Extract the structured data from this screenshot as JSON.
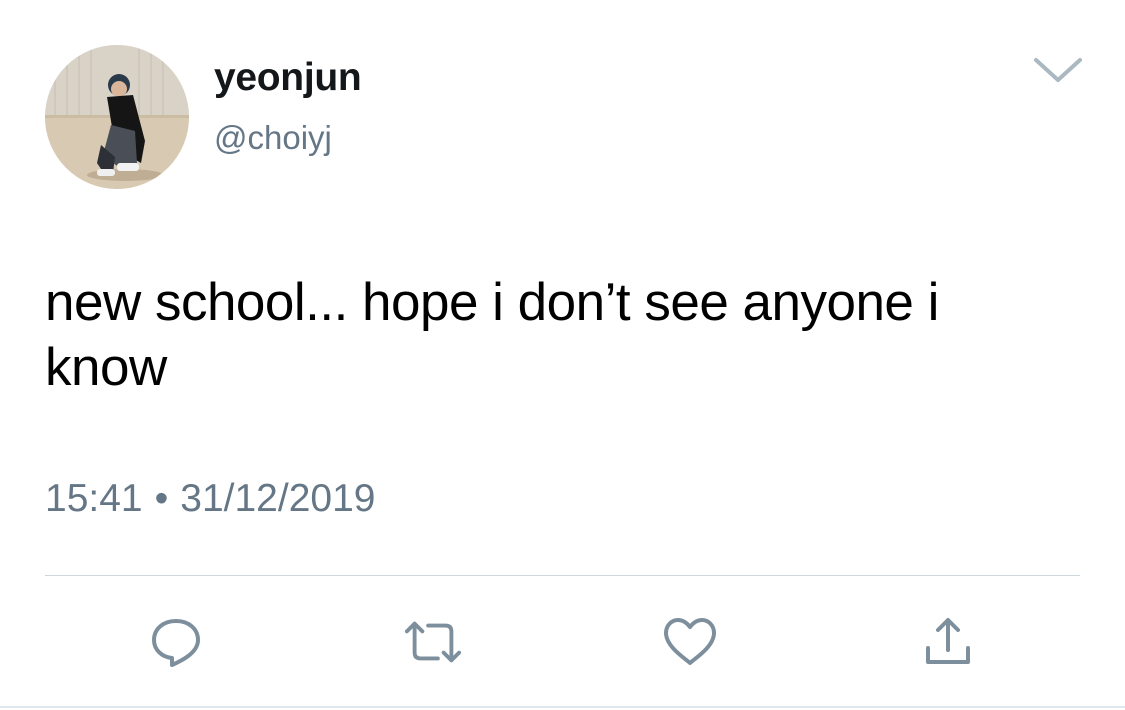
{
  "tweet": {
    "display_name": "yeonjun",
    "handle": "@choiyj",
    "text": "new school... hope i don’t see anyone i know",
    "time": "15:41",
    "separator": "•",
    "date": "31/12/2019"
  },
  "icons": {
    "caret": "chevron-down-icon",
    "reply": "reply-icon",
    "retweet": "retweet-icon",
    "like": "heart-icon",
    "share": "share-icon"
  },
  "colors": {
    "text": "#000000",
    "name": "#14171a",
    "secondary": "#657786",
    "divider": "#ccd6dd"
  }
}
